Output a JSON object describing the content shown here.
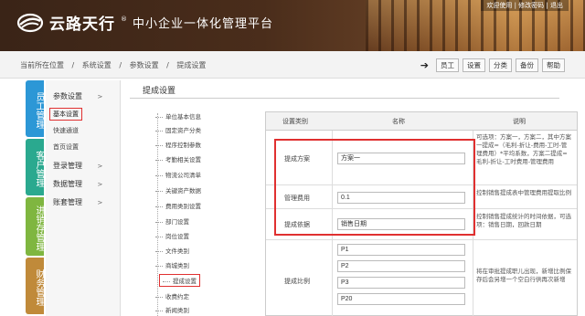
{
  "header": {
    "brand": "云路天行",
    "subtitle": "中小企业一体化管理平台",
    "links": "欢迎使用 | 修改密码 | 退出"
  },
  "breadcrumb": {
    "here": "当前所在位置",
    "sep": "/",
    "c1": "系统设置",
    "c2": "参数设置",
    "c3": "提成设置"
  },
  "toolbar": [
    "员工",
    "设置",
    "分类",
    "备份",
    "帮助"
  ],
  "vtabs": [
    "员工管理",
    "客户管理",
    "进销存管理",
    "财务管理"
  ],
  "leftmenu": {
    "group1": "参数设置",
    "items": [
      "基本设置",
      "快速通道",
      "首页设置"
    ],
    "group2": "登录管理",
    "group3": "数据管理",
    "group4": "账套管理",
    "arrow": ">"
  },
  "panel_title": "提成设置",
  "tree": [
    "单位基本信息",
    "固定资产分类",
    "程序控制参数",
    "考勤相关设置",
    "物流公司清单",
    "关键资产数据",
    "费用类别设置",
    "部门设置",
    "岗位设置",
    "文件类别",
    "商城类别",
    "提成设置",
    "收费约定",
    "新闻类别"
  ],
  "table": {
    "headers": [
      "设置类别",
      "名称",
      "说明"
    ],
    "rows": [
      {
        "label": "提成方案",
        "value": "方案一",
        "desc": "可选项：方案一，方案二，其中方案一提成=（毛利-折让-费用-工时-管理费用）*平均系数，方案二提成=毛利-折让-工时费用-管理费用"
      },
      {
        "label": "管理费用",
        "value": "0.1",
        "desc": "控制销售提成表中管理费用提取比例"
      },
      {
        "label": "提成依据",
        "value": "销售日期",
        "desc": "控制销售提成统计的时间依据，可选项：销售日期，回款日期"
      },
      {
        "label": "提成比例",
        "values": [
          "P1",
          "P2",
          "P3",
          "P20"
        ],
        "desc": "将在审批提成职儿出现，新增比例保存后会另增一个空白行供再次新增"
      }
    ]
  }
}
